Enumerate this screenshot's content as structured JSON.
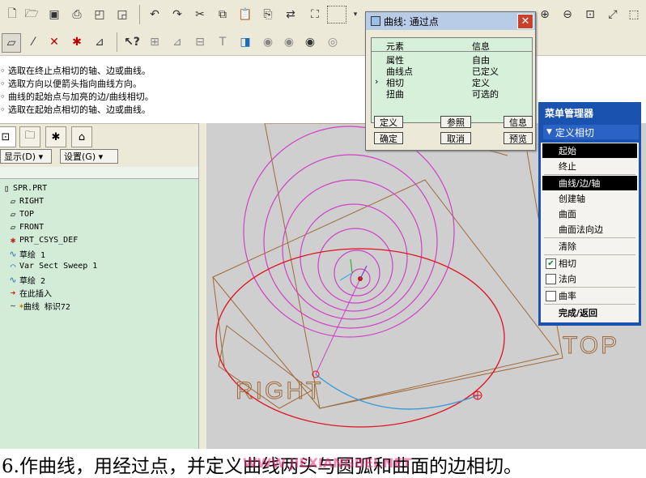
{
  "toolbar1": {
    "icons": [
      "new-file-icon",
      "open-folder-icon",
      "save-icon",
      "print-icon",
      "save-copy-icon",
      "close-window-icon",
      "undo-icon",
      "redo-icon",
      "cut-icon",
      "copy-icon",
      "paste-icon",
      "paste-special-icon",
      "regenerate-icon",
      "find-icon",
      "select-box-icon",
      "zoom-in-icon",
      "zoom-out-icon",
      "refit-icon",
      "orient-icon",
      "repaint-icon"
    ]
  },
  "toolbar2": {
    "icons": [
      "datum-plane-icon",
      "datum-axis-icon",
      "datum-point-icon",
      "coord-sys-icon",
      "analysis-icon",
      "whats-this-icon",
      "plane-display-icon",
      "axis-display-icon",
      "point-display-icon",
      "csys-display-icon",
      "shading-icon",
      "wireframe-icon",
      "hidden-line-icon",
      "no-hidden-icon",
      "spin-center-icon"
    ]
  },
  "messages": [
    "选取在终止点相切的轴、边或曲线。",
    "选取方向以便箭头指向曲线方向。",
    "曲线的起始点与加亮的边/曲线相切。",
    "选取在起始点相切的轴、边或曲线。"
  ],
  "left_panel": {
    "show_label": "显示(D)",
    "settings_label": "设置(G)",
    "tree": [
      {
        "label": "SPR.PRT",
        "icon": "part-icon"
      },
      {
        "label": "RIGHT",
        "icon": "datum-plane-icon"
      },
      {
        "label": "TOP",
        "icon": "datum-plane-icon"
      },
      {
        "label": "FRONT",
        "icon": "datum-plane-icon"
      },
      {
        "label": "PRT_CSYS_DEF",
        "icon": "coord-sys-icon"
      },
      {
        "label": "草绘 1",
        "icon": "sketch-icon"
      },
      {
        "label": "Var Sect Sweep 1",
        "icon": "sweep-icon"
      },
      {
        "label": "草绘 2",
        "icon": "sketch-icon"
      },
      {
        "label": "在此插入",
        "icon": "insert-here-icon"
      },
      {
        "label": "曲线 标识72",
        "icon": "curve-icon"
      }
    ]
  },
  "dialog": {
    "title": "曲线: 通过点",
    "col_element": "元素",
    "col_info": "信息",
    "rows": [
      {
        "element": "属性",
        "info": "自由"
      },
      {
        "element": "曲线点",
        "info": "已定义"
      },
      {
        "element": "相切",
        "info": "定义"
      },
      {
        "element": "扭曲",
        "info": "可选的"
      }
    ],
    "buttons": {
      "define": "定义",
      "ref": "参照",
      "info": "信息",
      "ok": "确定",
      "cancel": "取消",
      "preview": "预览"
    }
  },
  "menu_manager": {
    "title": "菜单管理器",
    "sub": "定义相切",
    "items": [
      {
        "label": "起始",
        "selected": true
      },
      {
        "label": "终止",
        "selected": false
      },
      {
        "label": "曲线/边/轴",
        "selected": true
      },
      {
        "label": "创建轴",
        "selected": false
      },
      {
        "label": "曲面",
        "selected": false
      },
      {
        "label": "曲面法向边",
        "selected": false
      },
      {
        "label": "清除",
        "selected": false
      }
    ],
    "checks": [
      {
        "label": "相切",
        "checked": true
      },
      {
        "label": "法向",
        "checked": false
      },
      {
        "label": "曲率",
        "checked": false
      }
    ],
    "done": "完成/返回"
  },
  "viewport": {
    "labels": {
      "right": "RIGHT",
      "top": "TOP"
    }
  },
  "caption": "6.作曲线，用经过点，并定义曲线两头与圆弧和曲面的边相切。",
  "watermark": "WWW.JIEXIANGBEI.NET"
}
